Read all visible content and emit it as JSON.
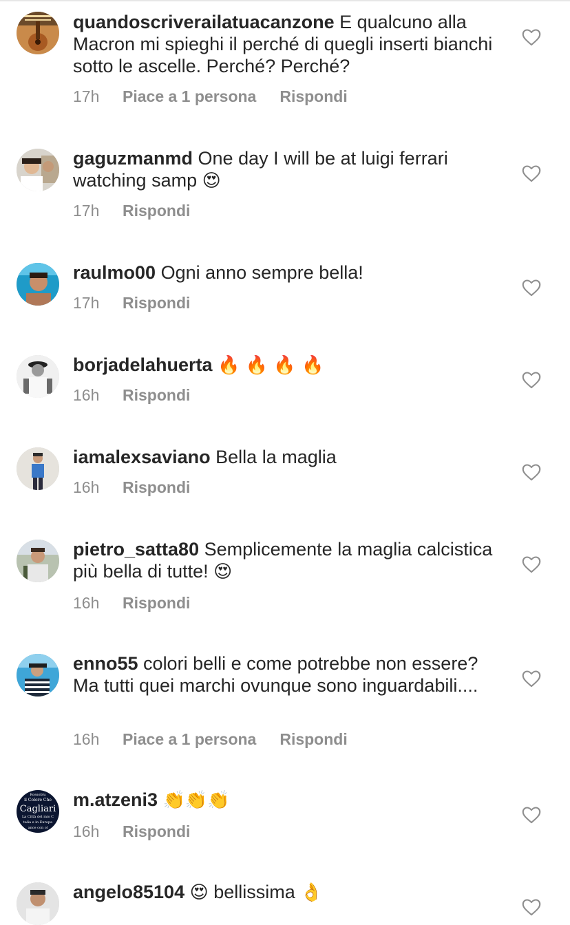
{
  "comments": [
    {
      "username": "quandoscriverailatuacanzone",
      "text": "E qualcuno alla Macron mi spieghi il perché di quegli inserti bianchi sotto le ascelle. Perché? Perché?",
      "emoji": "",
      "time": "17h",
      "likes": "Piace a 1 persona",
      "reply": "Rispondi",
      "avatar": "avatar-guitar-cover"
    },
    {
      "username": "gaguzmanmd",
      "text": "One day I will be at luigi ferrari watching samp",
      "emoji": "😍",
      "time": "17h",
      "likes": "",
      "reply": "Rispondi",
      "avatar": "avatar-selfie-man"
    },
    {
      "username": "raulmo00",
      "text": "Ogni anno sempre bella!",
      "emoji": "",
      "time": "17h",
      "likes": "",
      "reply": "Rispondi",
      "avatar": "avatar-pool-man"
    },
    {
      "username": "borjadelahuerta",
      "text": "",
      "emoji": "🔥 🔥 🔥 🔥",
      "time": "16h",
      "likes": "",
      "reply": "Rispondi",
      "avatar": "avatar-bw-hat-man"
    },
    {
      "username": "iamalexsaviano",
      "text": "Bella la maglia",
      "emoji": "",
      "time": "16h",
      "likes": "",
      "reply": "Rispondi",
      "avatar": "avatar-standing-man"
    },
    {
      "username": "pietro_satta80",
      "text": "Semplicemente la maglia calcistica più bella di tutte!",
      "emoji": "😍",
      "time": "16h",
      "likes": "",
      "reply": "Rispondi",
      "avatar": "avatar-man-outdoor"
    },
    {
      "username": "enno55",
      "text": "colori belli e come potrebbe non essere? Ma tutti quei marchi ovunque sono inguardabili....",
      "emoji": "",
      "time": "16h",
      "likes": "Piace a 1 persona",
      "reply": "Rispondi",
      "avatar": "avatar-man-boat"
    },
    {
      "username": "m.atzeni3",
      "text": "",
      "emoji": "👏👏👏",
      "time": "16h",
      "likes": "",
      "reply": "Rispondi",
      "avatar": "avatar-cagliari-badge",
      "avatar_text": [
        "Rossoblu",
        "il Colore Che",
        "Cagliari",
        "La Città del mio C",
        "talia e in Europa",
        "ance con ol"
      ]
    },
    {
      "username": "angelo85104",
      "text": "bellissima",
      "emoji_before": "😍",
      "emoji": "👌",
      "time": "",
      "likes": "",
      "reply": "",
      "avatar": "avatar-man-shirt"
    }
  ],
  "colors": {
    "text": "#262626",
    "meta": "#8e8e8e",
    "heart": "#8e8e8e",
    "divider": "#e6e6e6"
  },
  "icons": {
    "like": "heart-outline-icon"
  }
}
